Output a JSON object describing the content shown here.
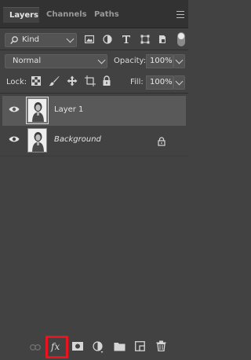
{
  "tabs": [
    {
      "label": "Layers",
      "active": true
    },
    {
      "label": "Channels",
      "active": false
    },
    {
      "label": "Paths",
      "active": false
    }
  ],
  "filter": {
    "kind_label": "Kind",
    "icons": [
      "pixel-filter-icon",
      "adjustment-filter-icon",
      "type-filter-icon",
      "shape-filter-icon",
      "smart-object-filter-icon"
    ]
  },
  "blend": {
    "mode": "Normal",
    "opacity_label": "Opacity:",
    "opacity_value": "100%"
  },
  "lock_row": {
    "lock_label": "Lock:",
    "fill_label": "Fill:",
    "fill_value": "100%"
  },
  "layers": [
    {
      "name": "Layer 1",
      "visible": true,
      "selected": true,
      "locked": false
    },
    {
      "name": "Background",
      "visible": true,
      "selected": false,
      "locked": true
    }
  ],
  "bottom": {
    "fx_label": "fx",
    "icons": [
      "link-layers-icon",
      "add-layer-style-icon",
      "add-mask-icon",
      "adjustment-layer-icon",
      "new-group-icon",
      "new-layer-icon",
      "delete-layer-icon"
    ]
  },
  "colors": {
    "panel_bg": "#424242",
    "selected_row": "#595959",
    "highlight": "#e8151e"
  }
}
